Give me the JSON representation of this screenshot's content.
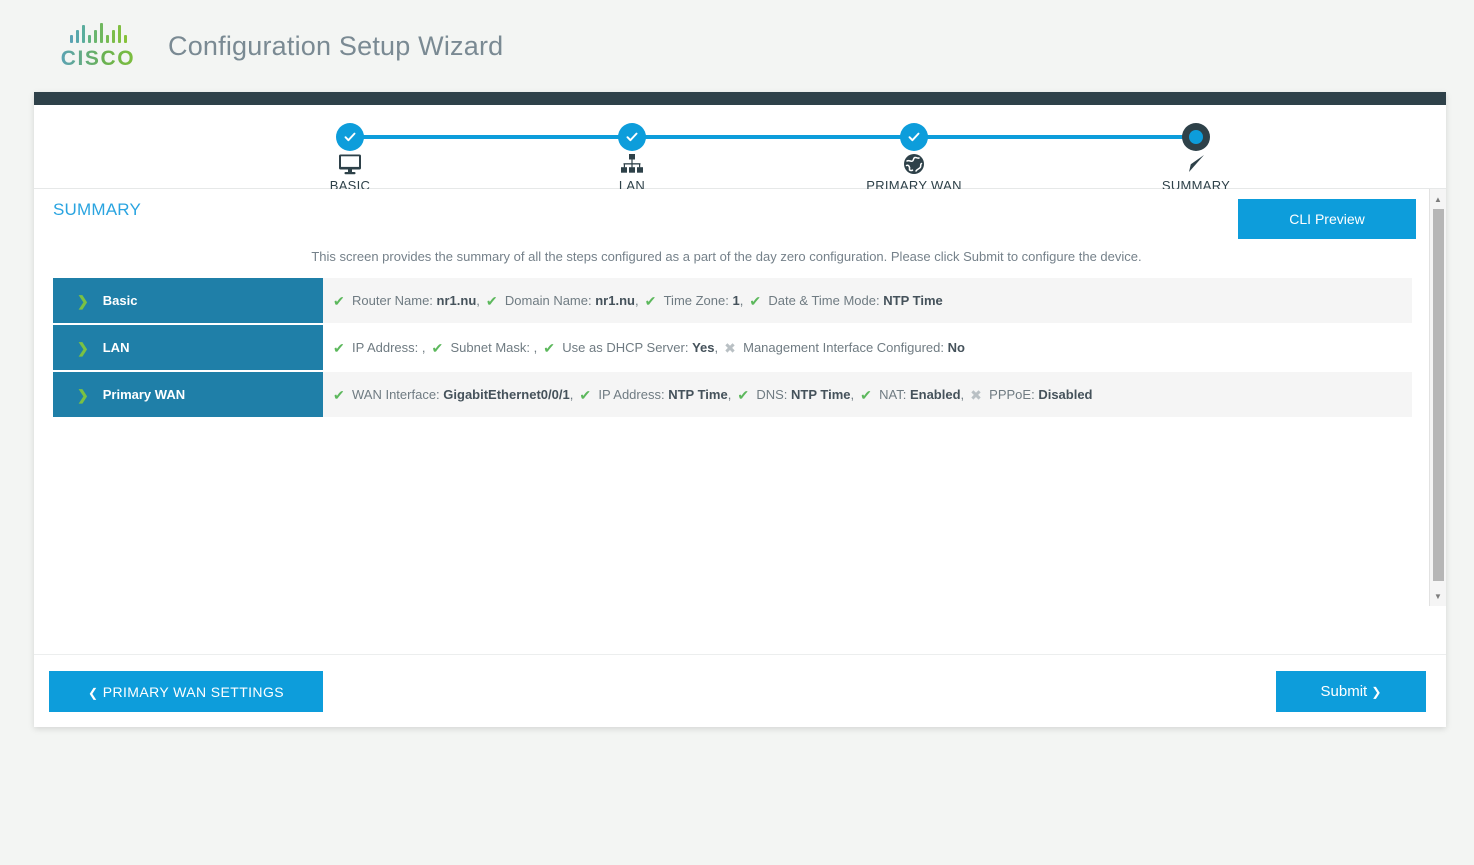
{
  "brand": {
    "logo_word": "CISCO",
    "logo_icon": "cisco-bars-logo"
  },
  "header": {
    "title": "Configuration Setup Wizard"
  },
  "stepper": {
    "steps": [
      {
        "label": "BASIC",
        "state": "complete",
        "icon": "monitor-icon"
      },
      {
        "label": "LAN",
        "state": "complete",
        "icon": "network-tree-icon"
      },
      {
        "label": "PRIMARY WAN",
        "state": "complete",
        "icon": "globe-icon"
      },
      {
        "label": "SUMMARY",
        "state": "current",
        "icon": "navigation-arrow-icon"
      }
    ]
  },
  "main": {
    "title": "SUMMARY",
    "cli_preview_label": "CLI Preview",
    "intro": "This screen provides the summary of all the steps configured as a part of the day zero configuration. Please click Submit to configure the device.",
    "sections": [
      {
        "name": "Basic",
        "items": [
          {
            "mark": "ok",
            "label": "Router Name:",
            "value": "nr1.nu",
            "trailing": ","
          },
          {
            "mark": "ok",
            "label": "Domain Name:",
            "value": "nr1.nu",
            "trailing": ","
          },
          {
            "mark": "ok",
            "label": "Time Zone:",
            "value": "1",
            "trailing": ","
          },
          {
            "mark": "ok",
            "label": "Date & Time Mode:",
            "value": "NTP Time",
            "trailing": ""
          }
        ]
      },
      {
        "name": "LAN",
        "items": [
          {
            "mark": "ok",
            "label": "IP Address:",
            "value": "",
            "trailing": ","
          },
          {
            "mark": "ok",
            "label": "Subnet Mask:",
            "value": "",
            "trailing": ","
          },
          {
            "mark": "ok",
            "label": "Use as DHCP Server:",
            "value": "Yes",
            "trailing": ","
          },
          {
            "mark": "no",
            "label": "Management Interface Configured:",
            "value": "No",
            "trailing": ""
          }
        ]
      },
      {
        "name": "Primary WAN",
        "items": [
          {
            "mark": "ok",
            "label": "WAN Interface:",
            "value": "GigabitEthernet0/0/1",
            "trailing": ","
          },
          {
            "mark": "ok",
            "label": "IP Address:",
            "value": "NTP Time",
            "trailing": ","
          },
          {
            "mark": "ok",
            "label": "DNS:",
            "value": "NTP Time",
            "trailing": ","
          },
          {
            "mark": "ok",
            "label": "NAT:",
            "value": "Enabled",
            "trailing": ","
          },
          {
            "mark": "no",
            "label": "PPPoE:",
            "value": "Disabled",
            "trailing": ""
          }
        ]
      }
    ]
  },
  "footer": {
    "back_label": "PRIMARY WAN SETTINGS",
    "submit_label": "Submit"
  },
  "colors": {
    "accent_blue": "#0d9ddb",
    "panel_blue": "#1f7fa8",
    "dark_slate": "#2e4149",
    "green_check": "#5cb85c",
    "green_chevron": "#7ac143",
    "title_blue": "#2aa4e0"
  }
}
